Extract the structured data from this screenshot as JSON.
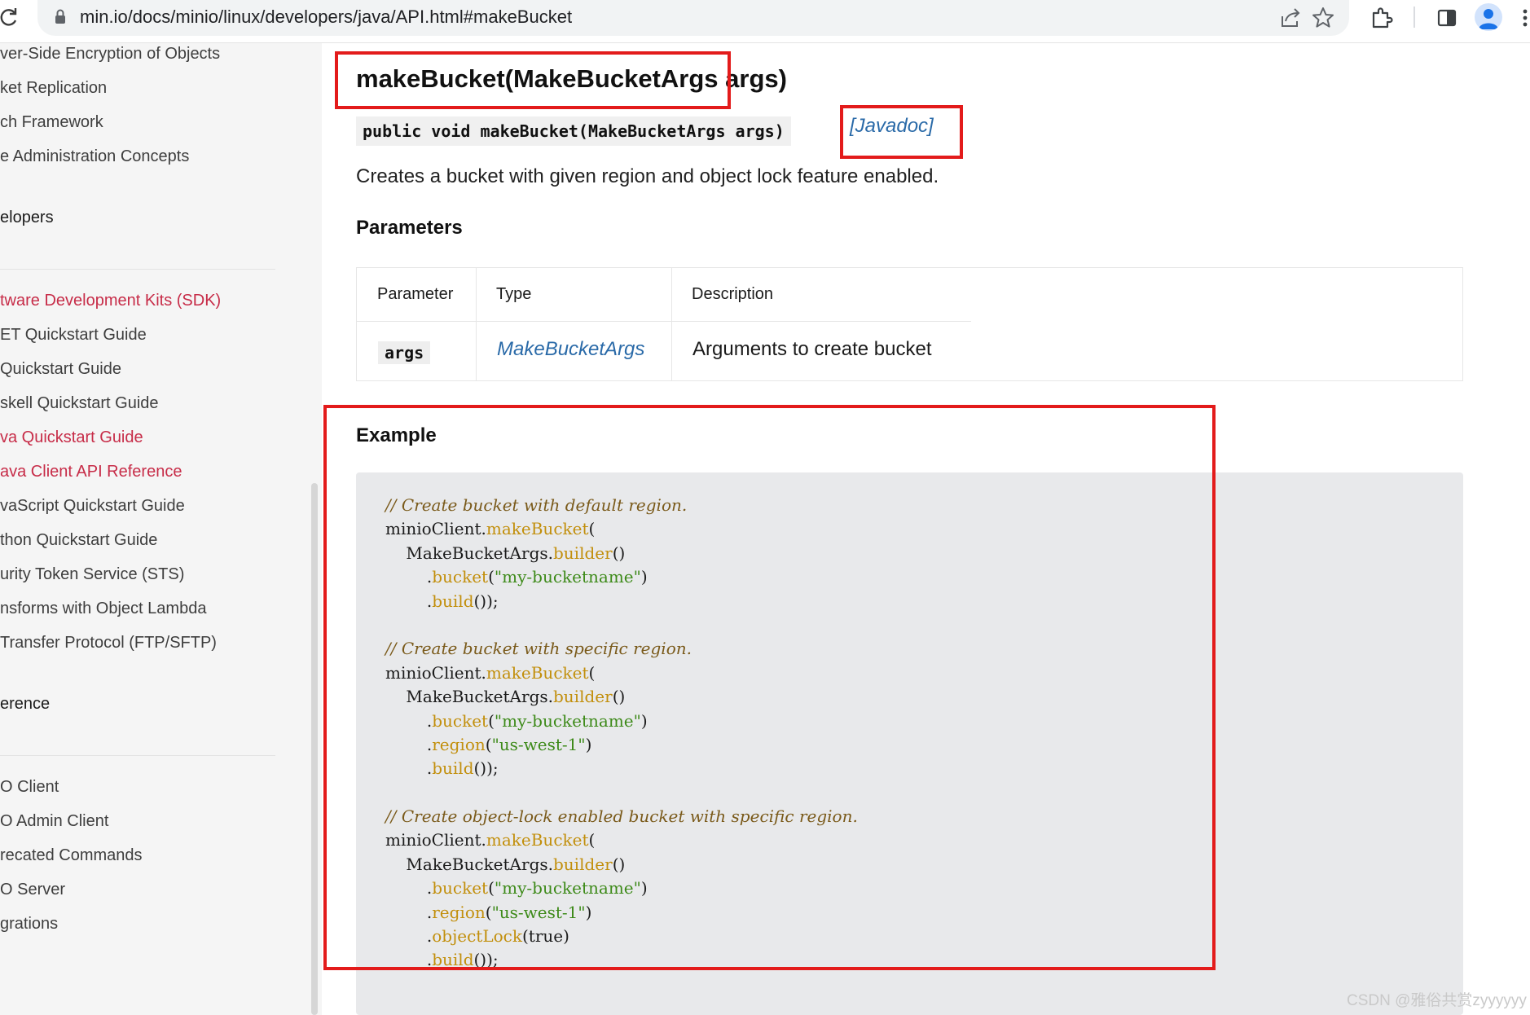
{
  "browser": {
    "url": "min.io/docs/minio/linux/developers/java/API.html#makeBucket"
  },
  "sidebar": {
    "items": [
      {
        "label": "ver-Side Encryption of Objects",
        "active": false
      },
      {
        "label": "ket Replication",
        "active": false
      },
      {
        "label": "ch Framework",
        "active": false
      },
      {
        "label": "e Administration Concepts",
        "active": false
      }
    ],
    "developers_heading": "elopers",
    "developer_items": [
      {
        "label": "tware Development Kits (SDK)",
        "active": true
      },
      {
        "label": "ET Quickstart Guide",
        "active": false
      },
      {
        "label": " Quickstart Guide",
        "active": false
      },
      {
        "label": "skell Quickstart Guide",
        "active": false
      },
      {
        "label": "va Quickstart Guide",
        "active": true
      },
      {
        "label": "ava Client API Reference",
        "active": true
      },
      {
        "label": "vaScript Quickstart Guide",
        "active": false
      },
      {
        "label": "thon Quickstart Guide",
        "active": false
      },
      {
        "label": "urity Token Service (STS)",
        "active": false
      },
      {
        "label": "nsforms with Object Lambda",
        "active": false
      },
      {
        "label": "Transfer Protocol (FTP/SFTP)",
        "active": false
      }
    ],
    "reference_heading": "erence",
    "reference_items": [
      {
        "label": "O Client",
        "active": false
      },
      {
        "label": "O Admin Client",
        "active": false
      },
      {
        "label": "recated Commands",
        "active": false
      },
      {
        "label": "O Server",
        "active": false
      },
      {
        "label": "grations",
        "active": false
      }
    ]
  },
  "main": {
    "method_title": "makeBucket(MakeBucketArgs args)",
    "signature": "public void makeBucket(MakeBucketArgs args)",
    "javadoc_link": "[Javadoc]",
    "description": "Creates a bucket with given region and object lock feature enabled.",
    "parameters_heading": "Parameters",
    "param_table": {
      "headers": [
        "Parameter",
        "Type",
        "Description"
      ],
      "rows": [
        {
          "parameter": "args",
          "type": "MakeBucketArgs",
          "description": "Arguments to create bucket"
        }
      ]
    },
    "example_heading": "Example",
    "code_lines": [
      [
        {
          "t": "// Create bucket with default region.",
          "k": "comment"
        }
      ],
      [
        {
          "t": "minioClient.",
          "k": "plain"
        },
        {
          "t": "makeBucket",
          "k": "method"
        },
        {
          "t": "(",
          "k": "plain"
        }
      ],
      [
        {
          "t": "    MakeBucketArgs.",
          "k": "plain"
        },
        {
          "t": "builder",
          "k": "method"
        },
        {
          "t": "()",
          "k": "plain"
        }
      ],
      [
        {
          "t": "        .",
          "k": "plain"
        },
        {
          "t": "bucket",
          "k": "method"
        },
        {
          "t": "(",
          "k": "plain"
        },
        {
          "t": "\"my-bucketname\"",
          "k": "string"
        },
        {
          "t": ")",
          "k": "plain"
        }
      ],
      [
        {
          "t": "        .",
          "k": "plain"
        },
        {
          "t": "build",
          "k": "method"
        },
        {
          "t": "());",
          "k": "plain"
        }
      ],
      [],
      [
        {
          "t": "// Create bucket with specific region.",
          "k": "comment"
        }
      ],
      [
        {
          "t": "minioClient.",
          "k": "plain"
        },
        {
          "t": "makeBucket",
          "k": "method"
        },
        {
          "t": "(",
          "k": "plain"
        }
      ],
      [
        {
          "t": "    MakeBucketArgs.",
          "k": "plain"
        },
        {
          "t": "builder",
          "k": "method"
        },
        {
          "t": "()",
          "k": "plain"
        }
      ],
      [
        {
          "t": "        .",
          "k": "plain"
        },
        {
          "t": "bucket",
          "k": "method"
        },
        {
          "t": "(",
          "k": "plain"
        },
        {
          "t": "\"my-bucketname\"",
          "k": "string"
        },
        {
          "t": ")",
          "k": "plain"
        }
      ],
      [
        {
          "t": "        .",
          "k": "plain"
        },
        {
          "t": "region",
          "k": "method"
        },
        {
          "t": "(",
          "k": "plain"
        },
        {
          "t": "\"us-west-1\"",
          "k": "string"
        },
        {
          "t": ")",
          "k": "plain"
        }
      ],
      [
        {
          "t": "        .",
          "k": "plain"
        },
        {
          "t": "build",
          "k": "method"
        },
        {
          "t": "());",
          "k": "plain"
        }
      ],
      [],
      [
        {
          "t": "// Create object-lock enabled bucket with specific region.",
          "k": "comment"
        }
      ],
      [
        {
          "t": "minioClient.",
          "k": "plain"
        },
        {
          "t": "makeBucket",
          "k": "method"
        },
        {
          "t": "(",
          "k": "plain"
        }
      ],
      [
        {
          "t": "    MakeBucketArgs.",
          "k": "plain"
        },
        {
          "t": "builder",
          "k": "method"
        },
        {
          "t": "()",
          "k": "plain"
        }
      ],
      [
        {
          "t": "        .",
          "k": "plain"
        },
        {
          "t": "bucket",
          "k": "method"
        },
        {
          "t": "(",
          "k": "plain"
        },
        {
          "t": "\"my-bucketname\"",
          "k": "string"
        },
        {
          "t": ")",
          "k": "plain"
        }
      ],
      [
        {
          "t": "        .",
          "k": "plain"
        },
        {
          "t": "region",
          "k": "method"
        },
        {
          "t": "(",
          "k": "plain"
        },
        {
          "t": "\"us-west-1\"",
          "k": "string"
        },
        {
          "t": ")",
          "k": "plain"
        }
      ],
      [
        {
          "t": "        .",
          "k": "plain"
        },
        {
          "t": "objectLock",
          "k": "method"
        },
        {
          "t": "(true)",
          "k": "plain"
        }
      ],
      [
        {
          "t": "        .",
          "k": "plain"
        },
        {
          "t": "build",
          "k": "method"
        },
        {
          "t": "());",
          "k": "plain"
        }
      ]
    ]
  },
  "watermark": "CSDN @雅俗共赏zyyyyyy",
  "colors": {
    "accent": "#c72c48",
    "link": "#2a6aa8",
    "highlight_box": "#e31b1b",
    "code_bg": "#e8e9eb"
  },
  "icons": [
    "reload-icon",
    "lock-icon",
    "share-icon",
    "star-icon",
    "extensions-icon",
    "side-panel-icon",
    "profile-icon",
    "menu-icon"
  ]
}
